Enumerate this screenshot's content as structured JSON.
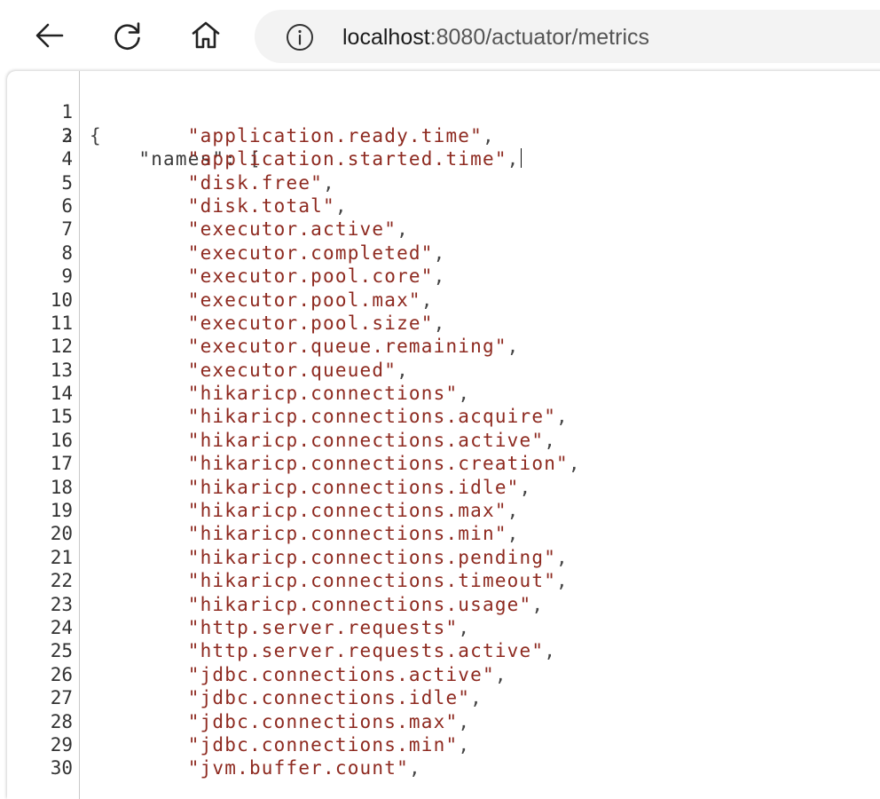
{
  "browser": {
    "nav": {
      "back_icon": "arrow-left-icon",
      "reload_icon": "reload-icon",
      "home_icon": "home-icon"
    },
    "address": {
      "info_icon": "info-circle-icon",
      "host": "localhost",
      "path": ":8080/actuator/metrics"
    }
  },
  "json_viewer": {
    "open_brace": "{",
    "key": "\"names\"",
    "key_suffix": ": [",
    "lines": [
      {
        "num": "1"
      },
      {
        "num": "2"
      },
      {
        "num": "3",
        "value": "\"application.ready.time\"",
        "suffix": ","
      },
      {
        "num": "4",
        "value": "\"application.started.time\"",
        "suffix": ","
      },
      {
        "num": "5",
        "value": "\"disk.free\"",
        "suffix": ","
      },
      {
        "num": "6",
        "value": "\"disk.total\"",
        "suffix": ","
      },
      {
        "num": "7",
        "value": "\"executor.active\"",
        "suffix": ","
      },
      {
        "num": "8",
        "value": "\"executor.completed\"",
        "suffix": ","
      },
      {
        "num": "9",
        "value": "\"executor.pool.core\"",
        "suffix": ","
      },
      {
        "num": "10",
        "value": "\"executor.pool.max\"",
        "suffix": ","
      },
      {
        "num": "11",
        "value": "\"executor.pool.size\"",
        "suffix": ","
      },
      {
        "num": "12",
        "value": "\"executor.queue.remaining\"",
        "suffix": ","
      },
      {
        "num": "13",
        "value": "\"executor.queued\"",
        "suffix": ","
      },
      {
        "num": "14",
        "value": "\"hikaricp.connections\"",
        "suffix": ","
      },
      {
        "num": "15",
        "value": "\"hikaricp.connections.acquire\"",
        "suffix": ","
      },
      {
        "num": "16",
        "value": "\"hikaricp.connections.active\"",
        "suffix": ","
      },
      {
        "num": "17",
        "value": "\"hikaricp.connections.creation\"",
        "suffix": ","
      },
      {
        "num": "18",
        "value": "\"hikaricp.connections.idle\"",
        "suffix": ","
      },
      {
        "num": "19",
        "value": "\"hikaricp.connections.max\"",
        "suffix": ","
      },
      {
        "num": "20",
        "value": "\"hikaricp.connections.min\"",
        "suffix": ","
      },
      {
        "num": "21",
        "value": "\"hikaricp.connections.pending\"",
        "suffix": ","
      },
      {
        "num": "22",
        "value": "\"hikaricp.connections.timeout\"",
        "suffix": ","
      },
      {
        "num": "23",
        "value": "\"hikaricp.connections.usage\"",
        "suffix": ","
      },
      {
        "num": "24",
        "value": "\"http.server.requests\"",
        "suffix": ","
      },
      {
        "num": "25",
        "value": "\"http.server.requests.active\"",
        "suffix": ","
      },
      {
        "num": "26",
        "value": "\"jdbc.connections.active\"",
        "suffix": ","
      },
      {
        "num": "27",
        "value": "\"jdbc.connections.idle\"",
        "suffix": ","
      },
      {
        "num": "28",
        "value": "\"jdbc.connections.max\"",
        "suffix": ","
      },
      {
        "num": "29",
        "value": "\"jdbc.connections.min\"",
        "suffix": ","
      },
      {
        "num": "30",
        "value": "\"jvm.buffer.count\"",
        "suffix": ","
      }
    ]
  }
}
